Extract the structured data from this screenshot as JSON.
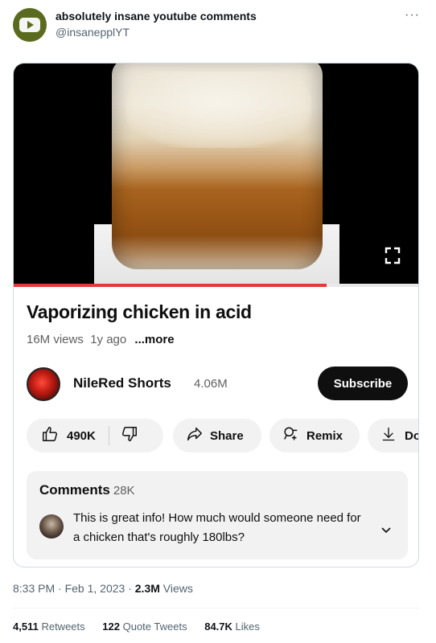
{
  "tweet": {
    "display_name": "absolutely insane youtube comments",
    "handle": "@insanepplYT",
    "more_icon": "more-dots-icon",
    "avatar_icon": "youtube-play-icon",
    "timestamp": "8:33 PM · Feb 1, 2023",
    "views_count": "2.3M",
    "views_label": "Views",
    "stats": {
      "retweets_count": "4,511",
      "retweets_label": "Retweets",
      "quotes_count": "122",
      "quotes_label": "Quote Tweets",
      "likes_count": "84.7K",
      "likes_label": "Likes"
    }
  },
  "video": {
    "title": "Vaporizing chicken in acid",
    "views": "16M views",
    "age": "1y ago",
    "more_label": "...more",
    "progress": 0.77,
    "progress_color": "#e53935",
    "fullscreen_icon": "fullscreen-icon"
  },
  "channel": {
    "name": "NileRed Shorts",
    "subscribers": "4.06M",
    "subscribe_label": "Subscribe"
  },
  "actions": {
    "likes": "490K",
    "share_label": "Share",
    "remix_label": "Remix",
    "download_label": "Do"
  },
  "comments": {
    "title": "Comments",
    "count": "28K",
    "top_comment": "This is great info! How much would someone need for a chicken that's roughly 180lbs?"
  },
  "colors": {
    "subscribe_bg": "#0f0f0f",
    "pill_bg": "#f2f2f2",
    "muted_text": "#536471"
  }
}
